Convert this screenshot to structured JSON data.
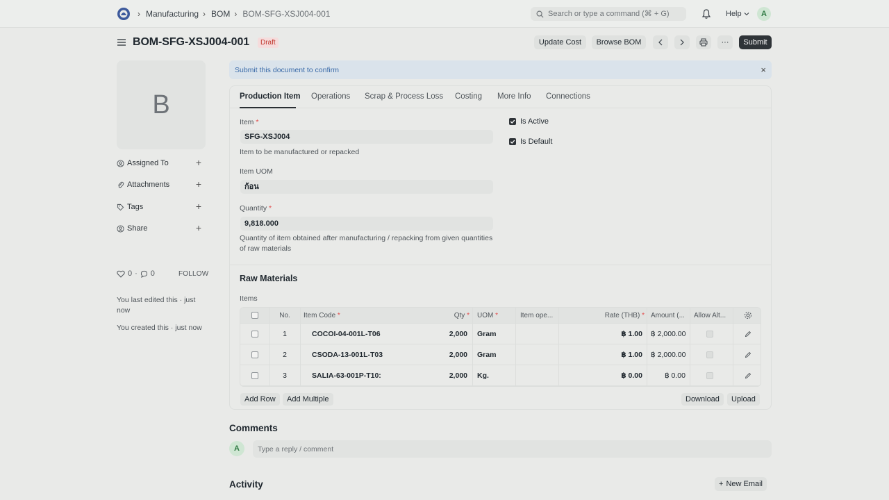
{
  "nav": {
    "breadcrumbs": [
      "Manufacturing",
      "BOM",
      "BOM-SFG-XSJ004-001"
    ],
    "search_placeholder": "Search or type a command (⌘ + G)",
    "help_label": "Help",
    "avatar_initial": "A"
  },
  "header": {
    "title": "BOM-SFG-XSJ004-001",
    "status": "Draft",
    "update_cost": "Update Cost",
    "browse_bom": "Browse BOM",
    "more": "···",
    "submit": "Submit"
  },
  "sidebar": {
    "image_initial": "B",
    "items": [
      "Assigned To",
      "Attachments",
      "Tags",
      "Share"
    ],
    "likes": "0",
    "comments_count": "0",
    "follow": "FOLLOW",
    "last_edited": "You last edited this · just now",
    "created": "You created this · just now"
  },
  "alert": {
    "text": "Submit this document to confirm",
    "close": "×"
  },
  "tabs": [
    "Production Item",
    "Operations",
    "Scrap & Process Loss",
    "Costing",
    "More Info",
    "Connections"
  ],
  "form": {
    "item_label": "Item",
    "item_value": "SFG-XSJ004",
    "item_desc": "Item to be manufactured or repacked",
    "uom_label": "Item UOM",
    "uom_value": "ก้อน",
    "qty_label": "Quantity",
    "qty_value": "9,818.000",
    "qty_desc": "Quantity of item obtained after manufacturing / repacking from given quantities of raw materials",
    "is_active": "Is Active",
    "is_default": "Is Default",
    "req": "*"
  },
  "raw_materials": {
    "title": "Raw Materials",
    "items_label": "Items",
    "columns": {
      "no": "No.",
      "item_code": "Item Code",
      "qty": "Qty",
      "uom": "UOM",
      "item_op": "Item ope...",
      "rate": "Rate (THB)",
      "amount": "Amount (...",
      "allow_alt": "Allow Alt..."
    },
    "rows": [
      {
        "no": "1",
        "item_code": "COCOI-04-001L-T06",
        "qty": "2,000",
        "uom": "Gram",
        "rate": "฿ 1.00",
        "amount": "฿ 2,000.00"
      },
      {
        "no": "2",
        "item_code": "CSODA-13-001L-T03",
        "qty": "2,000",
        "uom": "Gram",
        "rate": "฿ 1.00",
        "amount": "฿ 2,000.00"
      },
      {
        "no": "3",
        "item_code": "SALIA-63-001P-T10:",
        "qty": "2,000",
        "uom": "Kg.",
        "rate": "฿ 0.00",
        "amount": "฿ 0.00"
      }
    ],
    "add_row": "Add Row",
    "add_multiple": "Add Multiple",
    "download": "Download",
    "upload": "Upload"
  },
  "comments": {
    "title": "Comments",
    "avatar_initial": "A",
    "placeholder": "Type a reply / comment"
  },
  "activity": {
    "title": "Activity",
    "new_email": "New Email"
  }
}
